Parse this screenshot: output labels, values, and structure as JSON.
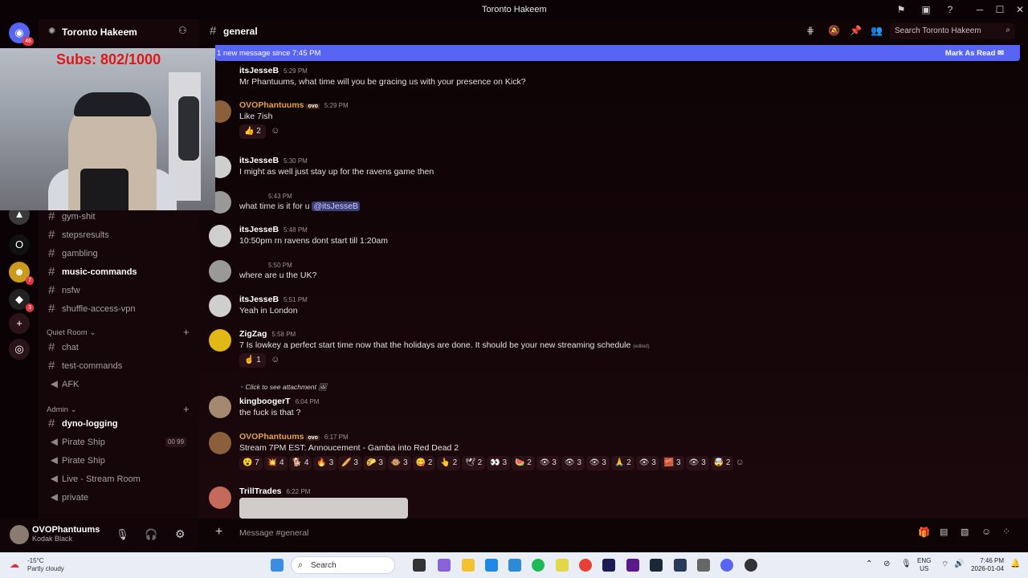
{
  "window": {
    "title": "Toronto Hakeem"
  },
  "server": {
    "name": "Toronto Hakeem"
  },
  "servers_badges": {
    "home": "46",
    "server2": "7",
    "server3": "3"
  },
  "webcam": {
    "overlay": "Subs: 802/1000"
  },
  "channels": [
    {
      "label": "gym-shit",
      "bold": false
    },
    {
      "label": "stepsresults",
      "bold": false
    },
    {
      "label": "gambling",
      "bold": false
    },
    {
      "label": "music-commands",
      "bold": true
    },
    {
      "label": "nsfw",
      "bold": false
    },
    {
      "label": "shuffle-access-vpn",
      "bold": false
    }
  ],
  "categories": [
    {
      "label": "Quiet Room",
      "channels": [
        "chat",
        "test-commands",
        "AFK"
      ]
    },
    {
      "label": "Admin",
      "channels": [
        "dyno-logging",
        "Pirate Ship",
        "Pirate Ship",
        "Live - Stream Room",
        "private"
      ]
    }
  ],
  "voice_badge": {
    "a": "00",
    "b": "99"
  },
  "user": {
    "name": "OVOPhantuums",
    "status": "Kodak Black"
  },
  "chat": {
    "channel": "general",
    "new_banner": "1 new message since 7:45 PM",
    "mark_read": "Mark As Read",
    "search_placeholder": "Search Toronto Hakeem",
    "composer_placeholder": "Message #general"
  },
  "messages": [
    {
      "author": "itsJesseB",
      "time": "5:29 PM",
      "text": "Mr Phantuums, what time will you be gracing us with your presence on Kick?"
    },
    {
      "author": "OVOPhantuums",
      "tag": "ovo",
      "time": "5:29 PM",
      "text": "Like 7ish",
      "reactions": [
        {
          "emoji": "👍",
          "count": "2"
        }
      ]
    },
    {
      "author": "itsJesseB",
      "time": "5:30 PM",
      "text": "I might as well just stay up for the ravens game then"
    },
    {
      "author": "",
      "time": "5:43 PM",
      "text": "what time is it for u",
      "mention": "@itsJesseB"
    },
    {
      "author": "itsJesseB",
      "time": "5:48 PM",
      "text": "10:50pm rn ravens dont start till 1:20am"
    },
    {
      "author": "",
      "time": "5:50 PM",
      "text": "where are u the UK?"
    },
    {
      "author": "itsJesseB",
      "time": "5:51 PM",
      "text": "Yeah in London"
    },
    {
      "author": "ZigZag",
      "time": "5:58 PM",
      "text": "7 Is lowkey a perfect start time now that the holidays are done. It should be your new streaming schedule",
      "edited": "(edited)",
      "reactions": [
        {
          "emoji": "☝",
          "count": "1"
        }
      ]
    },
    {
      "author": "kingboogerT",
      "time": "6:04 PM",
      "reply": "Click to see attachment",
      "text": "the fuck is that ?"
    },
    {
      "author": "OVOPhantuums",
      "tag": "ovo",
      "time": "6:17 PM",
      "text": "Stream 7PM EST: Annoucement - Gamba into Red Dead 2",
      "reactions": [
        {
          "emoji": "😮",
          "count": "7"
        },
        {
          "emoji": "💥",
          "count": "4"
        },
        {
          "emoji": "🐕",
          "count": "4"
        },
        {
          "emoji": "🔥",
          "count": "3"
        },
        {
          "emoji": "🥖",
          "count": "3"
        },
        {
          "emoji": "🌮",
          "count": "3"
        },
        {
          "emoji": "🐵",
          "count": "3"
        },
        {
          "emoji": "😋",
          "count": "2"
        },
        {
          "emoji": "👆",
          "count": "2"
        },
        {
          "emoji": "🕊",
          "count": "2"
        },
        {
          "emoji": "👀",
          "count": "3"
        },
        {
          "emoji": "🍉",
          "count": "2"
        },
        {
          "emoji": "👁",
          "count": "3"
        },
        {
          "emoji": "👁",
          "count": "3"
        },
        {
          "emoji": "👁",
          "count": "3"
        },
        {
          "emoji": "🙏",
          "count": "2"
        },
        {
          "emoji": "👁",
          "count": "3"
        },
        {
          "emoji": "🧱",
          "count": "3"
        },
        {
          "emoji": "👁",
          "count": "3"
        },
        {
          "emoji": "🤯",
          "count": "2"
        }
      ]
    },
    {
      "author": "TrillTrades",
      "time": "6:22 PM",
      "text": ""
    }
  ],
  "taskbar": {
    "temp": "-15°C",
    "weather": "Partly cloudy",
    "search": "Search",
    "lang1": "ENG",
    "lang2": "US",
    "time": "7:46 PM",
    "date": "2026-01-04"
  },
  "colors": {
    "accent": "#5865f2",
    "gold": "#e5a24a",
    "bg": "#0c0406"
  }
}
